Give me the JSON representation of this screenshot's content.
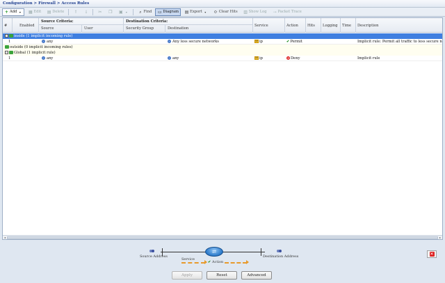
{
  "breadcrumb": "Configuration > Firewall > Access Rules",
  "toolbar": {
    "add": "Add",
    "edit": "Edit",
    "delete": "Delete",
    "find": "Find",
    "diagram": "Diagram",
    "export": "Export",
    "clear_hits": "Clear Hits",
    "show_log": "Show Log",
    "packet_trace": "Packet Trace"
  },
  "columns": {
    "num": "#",
    "enabled": "Enabled",
    "source_group": "Source Criteria:",
    "source": "Source",
    "user": "User",
    "dest_group": "Destination Criteria:",
    "security_group": "Security Group",
    "destination": "Destination",
    "service": "Service",
    "action": "Action",
    "hits": "Hits",
    "logging": "Logging",
    "time": "Time",
    "description": "Description"
  },
  "groups": [
    {
      "label": "inside (1 implicit incoming rule)",
      "selected": true
    },
    {
      "label": "outside (0 implicit incoming rules)",
      "selected": false
    },
    {
      "label": "Global (1 implicit rule)",
      "selected": false
    }
  ],
  "rules": [
    {
      "num": "1",
      "source": "any",
      "destination": "Any less secure networks",
      "service": "ip",
      "action": "Permit",
      "description": "Implicit rule: Permit all traffic to less secure networks"
    },
    {
      "num": "1",
      "source": "any",
      "destination": "any",
      "service": "ip",
      "action": "Deny",
      "description": "Implicit rule"
    }
  ],
  "diagram": {
    "source_address": "Source Address",
    "destination_address": "Destination Address",
    "service": "Service",
    "action": "Action"
  },
  "buttons": {
    "apply": "Apply",
    "reset": "Reset",
    "advanced": "Advanced"
  },
  "colors": {
    "selected_row": "#3f7fe0",
    "permit": "#1a8a1a",
    "deny": "#d22222",
    "flow_arrow": "#e89a2a"
  }
}
